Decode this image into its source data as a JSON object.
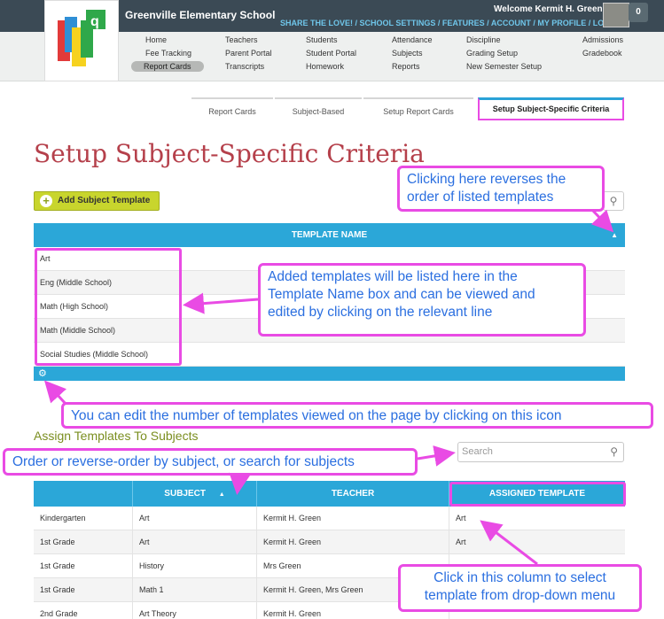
{
  "header": {
    "school_name": "Greenville Elementary School",
    "welcome": "Welcome Kermit H. Green",
    "top_links": "SHARE THE LOVE! / SCHOOL SETTINGS / FEATURES / ACCOUNT / MY PROFILE / LOG OFF",
    "notification_count": "0"
  },
  "nav": {
    "home": "Home",
    "fee_tracking": "Fee Tracking",
    "report_cards": "Report Cards",
    "teachers": "Teachers",
    "parent_portal": "Parent Portal",
    "transcripts": "Transcripts",
    "students": "Students",
    "student_portal": "Student Portal",
    "homework": "Homework",
    "attendance": "Attendance",
    "subjects": "Subjects",
    "reports": "Reports",
    "discipline": "Discipline",
    "grading_setup": "Grading Setup",
    "new_semester_setup": "New Semester Setup",
    "admissions": "Admissions",
    "gradebook": "Gradebook"
  },
  "tabs": {
    "report_cards": "Report Cards",
    "subject_based": "Subject-Based",
    "setup_report_cards": "Setup Report Cards",
    "setup_subject_specific": "Setup Subject-Specific Criteria"
  },
  "page_title": "Setup Subject-Specific Criteria",
  "add_template_label": "Add Subject Template",
  "template_table": {
    "header": "TEMPLATE NAME",
    "rows": [
      "Art",
      "Eng (Middle School)",
      "Math (High School)",
      "Math (Middle School)",
      "Social Studies (Middle School)"
    ]
  },
  "assign_section": {
    "title": "Assign Templates To Subjects",
    "search_placeholder": "Search",
    "columns": [
      "",
      "SUBJECT",
      "TEACHER",
      "ASSIGNED TEMPLATE"
    ],
    "rows": [
      [
        "Kindergarten",
        "Art",
        "Kermit H. Green",
        "Art"
      ],
      [
        "1st Grade",
        "Art",
        "Kermit H. Green",
        "Art"
      ],
      [
        "1st Grade",
        "History",
        "Mrs Green",
        ""
      ],
      [
        "1st Grade",
        "Math 1",
        "Kermit H. Green, Mrs Green",
        ""
      ],
      [
        "2nd Grade",
        "Art Theory",
        "Kermit H. Green",
        ""
      ]
    ]
  },
  "callouts": {
    "reverse_order": "Clicking here reverses the order of listed templates",
    "templates_listed": "Added templates will be listed here in the Template Name box and can be viewed and edited by clicking on the relevant line",
    "edit_count": "You can edit the number of templates viewed on the page by clicking on this icon",
    "order_subject": "Order or reverse-order by subject, or search for subjects",
    "select_template": "Click in this column to select template from drop-down menu"
  },
  "colors": {
    "header_dark": "#3b4a55",
    "accent_blue": "#2ba7d8",
    "title_red": "#b5404b",
    "button_green": "#c8d52d",
    "callout_pink": "#e94be4",
    "callout_text": "#2b6fe0"
  }
}
